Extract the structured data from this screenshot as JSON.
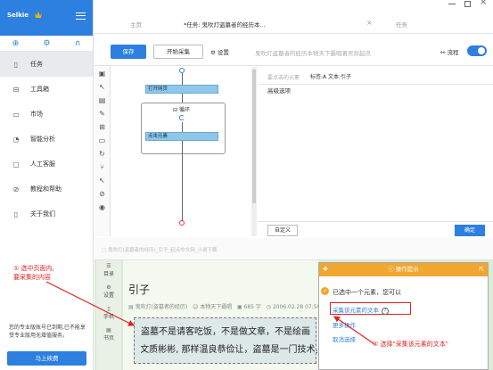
{
  "sidebar": {
    "brand": "Selkie",
    "items": [
      {
        "label": "任务",
        "icon": "document-icon",
        "glyph": "▯"
      },
      {
        "label": "工具箱",
        "icon": "toolbox-icon",
        "glyph": "⊟"
      },
      {
        "label": "市场",
        "icon": "market-icon",
        "glyph": "▭"
      },
      {
        "label": "智能分析",
        "icon": "analytics-icon",
        "glyph": "◔"
      },
      {
        "label": "人工客服",
        "icon": "support-icon",
        "glyph": "▢"
      },
      {
        "label": "教程和帮助",
        "icon": "help-icon",
        "glyph": "⊘"
      },
      {
        "label": "关于我们",
        "icon": "about-icon",
        "glyph": "▯"
      }
    ],
    "note": "您的专业版账号已到期,已不能享受专业版用无增值服务。",
    "renew_button": "马上续费"
  },
  "tabs": {
    "home": "主页",
    "active_task": "*任务: 鬼吹灯盗墓者的经历本...",
    "task": "任务"
  },
  "toolbar": {
    "save": "保存",
    "start_collect": "开始采集",
    "settings": "设置",
    "task_name": "鬼吹灯盗墓者的经历本物天下霸唱著灵异起点",
    "flow": "流程"
  },
  "flow": {
    "open_page": "打开网页",
    "loop": "循环",
    "click_element": "点击元素"
  },
  "right_panel": {
    "selected_label": "要点击的元素",
    "tag_info": "标签:A 文本:引子",
    "advanced": "高级选项",
    "custom_button": "自定义",
    "ok_button": "确定"
  },
  "browser": {
    "url": "鬼吹灯(盗墓者的经历)_引子_起点中文网_小说下载",
    "tools": [
      "目录",
      "设置",
      "手机",
      "书页"
    ],
    "article_title": "引子",
    "meta_book": "鬼吹灯(盗墓者的经历)",
    "meta_chapter": "本物天下霸唱",
    "meta_words": "685 字",
    "meta_time": "2006.02.28 07:50",
    "text_line1": "盗墓不是请客吃饭，不是做文章，不是绘画",
    "text_line2": "迫,文质彬彬, 那样温良恭俭让，盗墓是一门技术，一门"
  },
  "popup": {
    "title": "操作提示",
    "message": "已选中一个元素，您可以",
    "collect_text": "采集该元素的文本",
    "more_ops": "更多操作",
    "cancel": "取消选择"
  },
  "annotations": {
    "left": "① 选中页面内,\n要采集的内容",
    "right": "② 选择\"采集该元素的文本\""
  },
  "colors": {
    "primary": "#2d7fe0",
    "orange": "#f0a72f",
    "annotation": "#e02020"
  }
}
